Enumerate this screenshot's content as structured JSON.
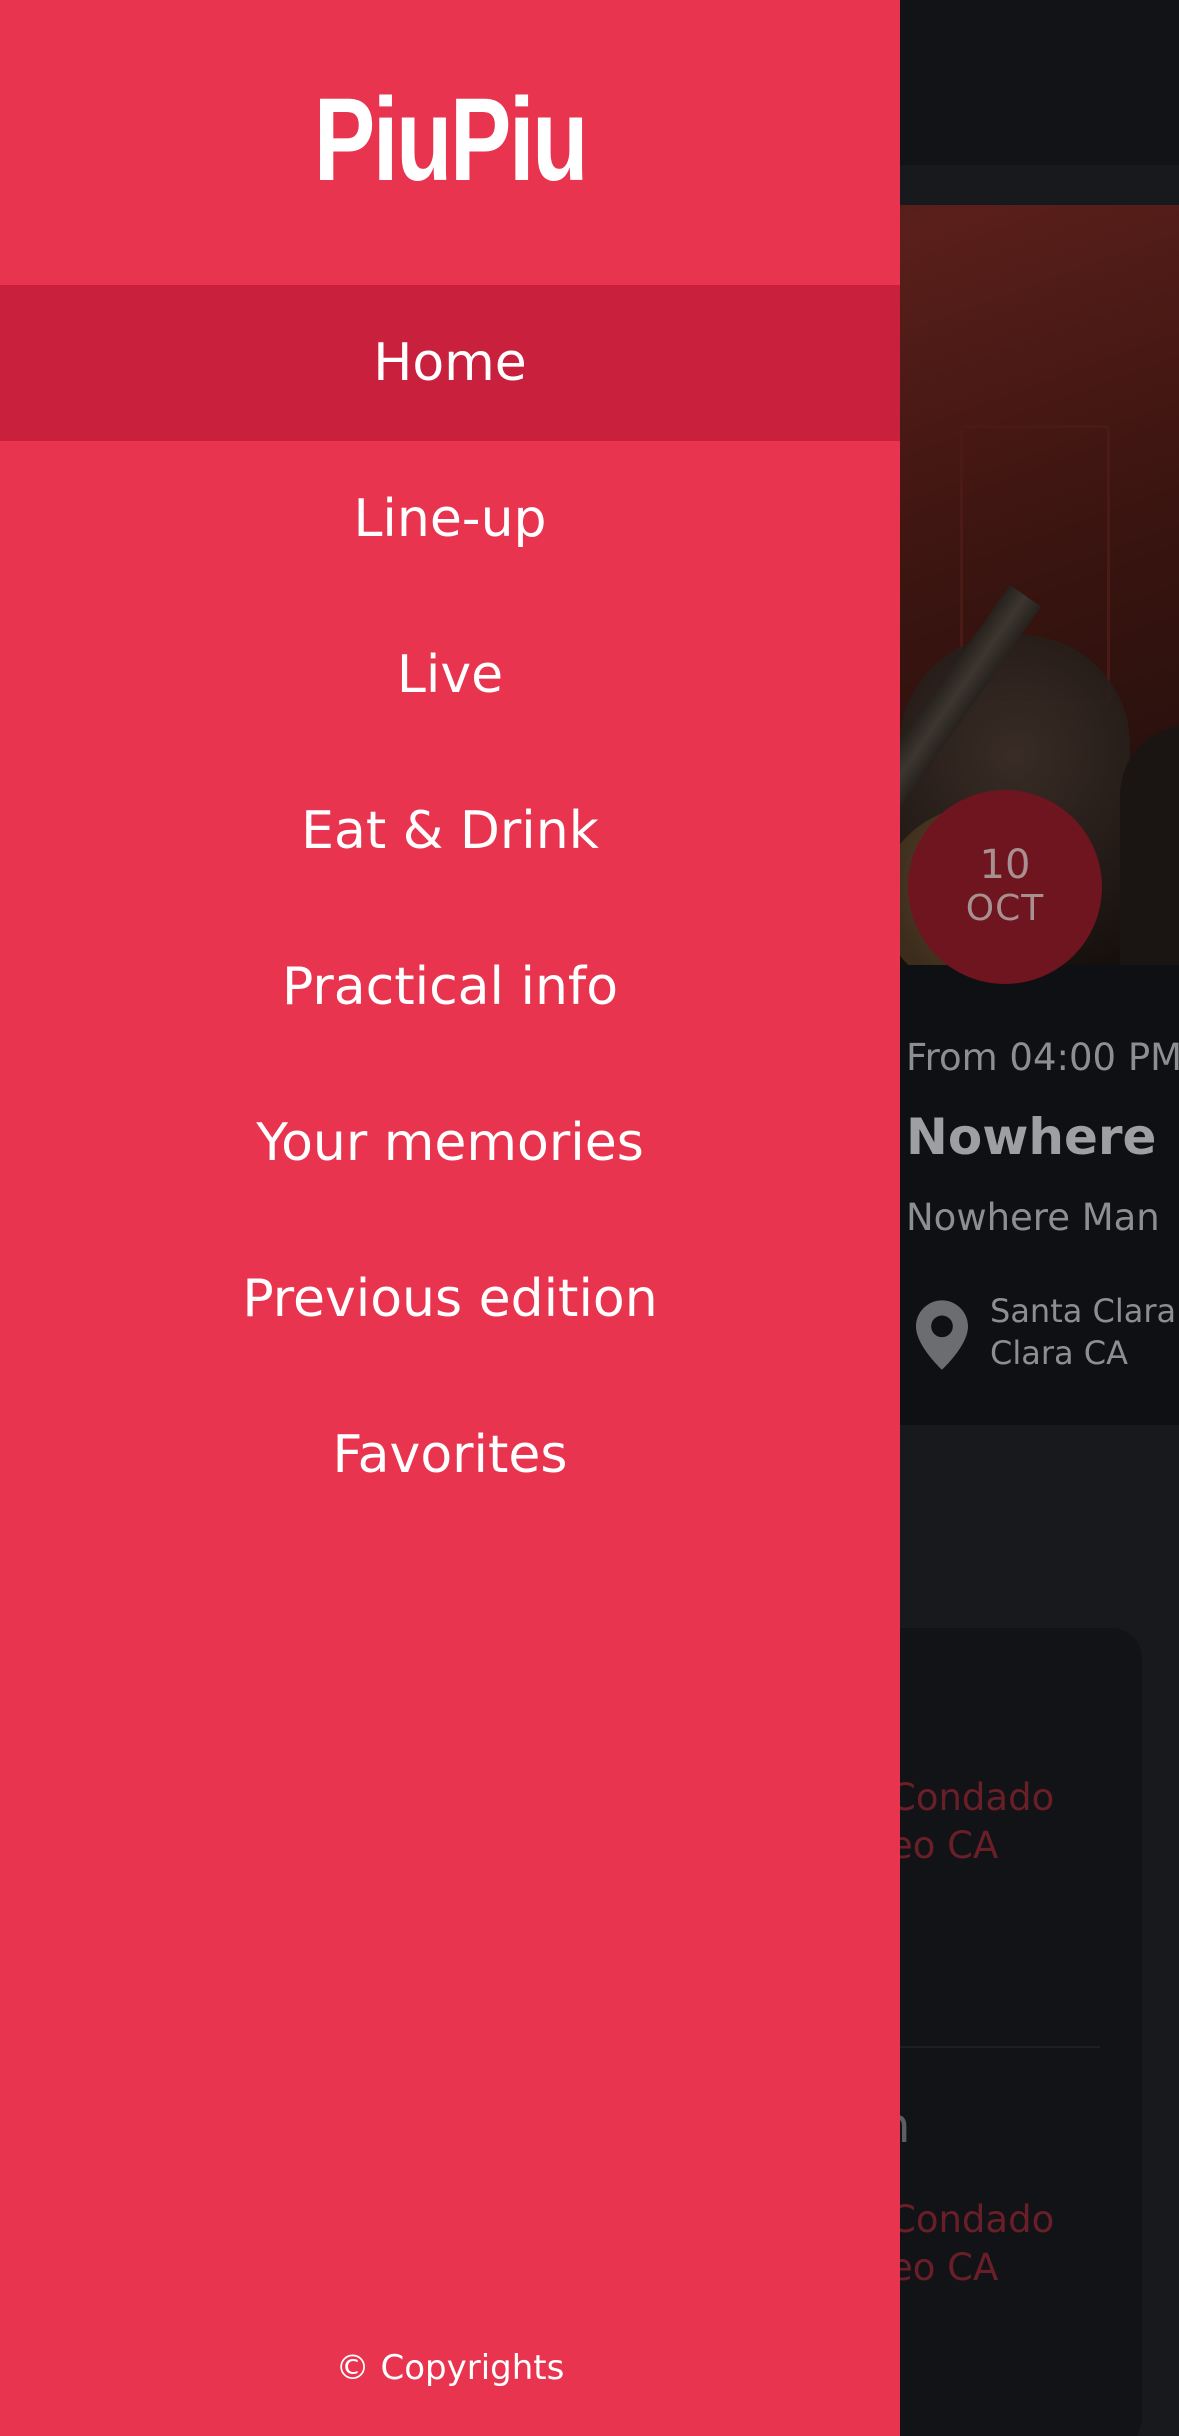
{
  "drawer": {
    "logo": "PiuPiu",
    "menu": [
      {
        "label": "Home",
        "active": true
      },
      {
        "label": "Line-up",
        "active": false
      },
      {
        "label": "Live",
        "active": false
      },
      {
        "label": "Eat & Drink",
        "active": false
      },
      {
        "label": "Practical info",
        "active": false
      },
      {
        "label": "Your memories",
        "active": false
      },
      {
        "label": "Previous edition",
        "active": false
      },
      {
        "label": "Favorites",
        "active": false
      }
    ],
    "copyright": "© Copyrights"
  },
  "featured_event": {
    "date_day": "10",
    "date_month": "OCT",
    "time": "From 04:00 PM",
    "title": "Nowhere",
    "subtitle": "Nowhere Man",
    "location_line1": "Santa Clara",
    "location_line2": "Clara CA"
  },
  "event_list": {
    "item1_location_line1": "Condado",
    "item1_location_line2": "eo CA",
    "item2_title_tail": "n",
    "item2_location_line1": "Condado",
    "item2_location_line2": "eo CA"
  },
  "colors": {
    "drawer_background": "#e9344f",
    "drawer_active_item": "#c9203d",
    "app_background": "#17191d"
  }
}
